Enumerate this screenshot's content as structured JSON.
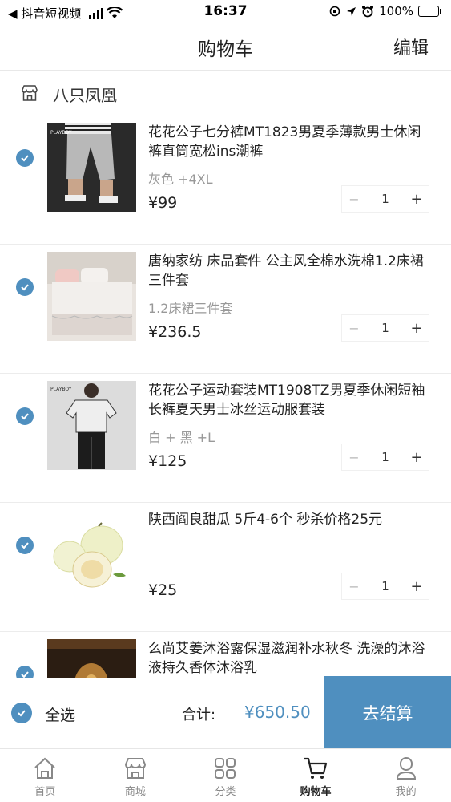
{
  "status_bar": {
    "back_label": "◀ 抖音短视频",
    "time": "16:37",
    "battery": "100%"
  },
  "nav": {
    "title": "购物车",
    "edit": "编辑"
  },
  "shop": {
    "name": "八只凤凰"
  },
  "items": [
    {
      "title": "花花公子七分裤MT1823男夏季薄款男士休闲裤直筒宽松ins潮裤",
      "spec": "灰色 +4XL",
      "price": "¥99",
      "qty": "1",
      "checked": true
    },
    {
      "title": "唐纳家纺 床品套件 公主风全棉水洗棉1.2床裙三件套",
      "spec": "1.2床裙三件套",
      "price": "¥236.5",
      "qty": "1",
      "checked": true
    },
    {
      "title": "花花公子运动套装MT1908TZ男夏季休闲短袖长裤夏天男士冰丝运动服套装",
      "spec": "白 + 黑 +L",
      "price": "¥125",
      "qty": "1",
      "checked": true
    },
    {
      "title": "陕西阎良甜瓜  5斤4-6个  秒杀价格25元",
      "spec": "",
      "price": "¥25",
      "qty": "1",
      "checked": true
    },
    {
      "title": "么尚艾姜沐浴露保湿滋润补水秋冬 洗澡的沐浴液持久香体沐浴乳",
      "spec": "",
      "price": "",
      "qty": "",
      "checked": true
    }
  ],
  "checkout": {
    "select_all": "全选",
    "total_label": "合计:",
    "total": "¥650.50",
    "pay": "去结算"
  },
  "tabs": [
    {
      "label": "首页",
      "icon": "home-icon",
      "active": false
    },
    {
      "label": "商城",
      "icon": "store-icon",
      "active": false
    },
    {
      "label": "分类",
      "icon": "grid-icon",
      "active": false
    },
    {
      "label": "购物车",
      "icon": "cart-icon",
      "active": true
    },
    {
      "label": "我的",
      "icon": "profile-icon",
      "active": false
    }
  ],
  "colors": {
    "accent": "#4f8fbf",
    "battery_green": "#3cc24a"
  }
}
